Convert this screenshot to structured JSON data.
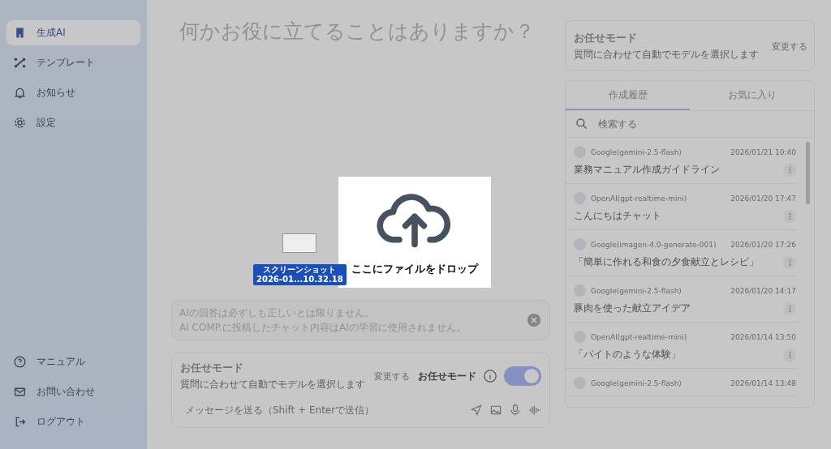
{
  "sidebar": {
    "items": [
      {
        "label": "生成AI",
        "selected": true
      },
      {
        "label": "テンプレート",
        "selected": false
      },
      {
        "label": "お知らせ",
        "selected": false
      },
      {
        "label": "設定",
        "selected": false
      }
    ],
    "footer_items": [
      "マニュアル",
      "お問い合わせ",
      "ログアウト"
    ]
  },
  "main": {
    "heading": "何かお役に立てることはありますか？",
    "notice": [
      "AIの回答は必ずしも正しいとは限りません。",
      "AI COMP.に投稿したチャット内容はAIの学習に使用されません。"
    ],
    "composer": {
      "mode_title": "お任せモード",
      "mode_description": "質問に合わせて自動でモデルを選択します",
      "change_button": "変更する",
      "mode_label": "お任せモード",
      "auto_mode_on": true,
      "placeholder": "メッセージを送る（Shift + Enterで送信）"
    }
  },
  "right_panel": {
    "mode_card": {
      "title": "お任せモード",
      "description": "質問に合わせて自動でモデルを選択します",
      "change_button": "変更する"
    },
    "tabs": [
      {
        "label": "作成履歴",
        "selected": true
      },
      {
        "label": "お気に入り",
        "selected": false
      }
    ],
    "search": {
      "placeholder": "検索する"
    },
    "history": [
      {
        "model": "Google(gemini-2.5-flash)",
        "date": "2026/01/21 10:40",
        "title": "業務マニュアル作成ガイドライン"
      },
      {
        "model": "OpenAI(gpt-realtime-mini)",
        "date": "2026/01/20 17:47",
        "title": "こんにちはチャット"
      },
      {
        "model": "Google(imagen-4.0-generate-001)",
        "date": "2026/01/20 17:26",
        "title": "「簡単に作れる和食の夕食献立とレシピ」"
      },
      {
        "model": "Google(gemini-2.5-flash)",
        "date": "2026/01/20 14:17",
        "title": "豚肉を使った献立アイデア"
      },
      {
        "model": "OpenAI(gpt-realtime-mini)",
        "date": "2026/01/14 13:50",
        "title": "「バイトのような体験」"
      },
      {
        "model": "Google(gemini-2.5-flash)",
        "date": "2026/01/14 13:48"
      }
    ]
  },
  "drop_overlay": {
    "message": "ここにファイルをドロップ",
    "dragged_file": [
      "スクリーンショット",
      "2026-01...10.32.18"
    ]
  }
}
